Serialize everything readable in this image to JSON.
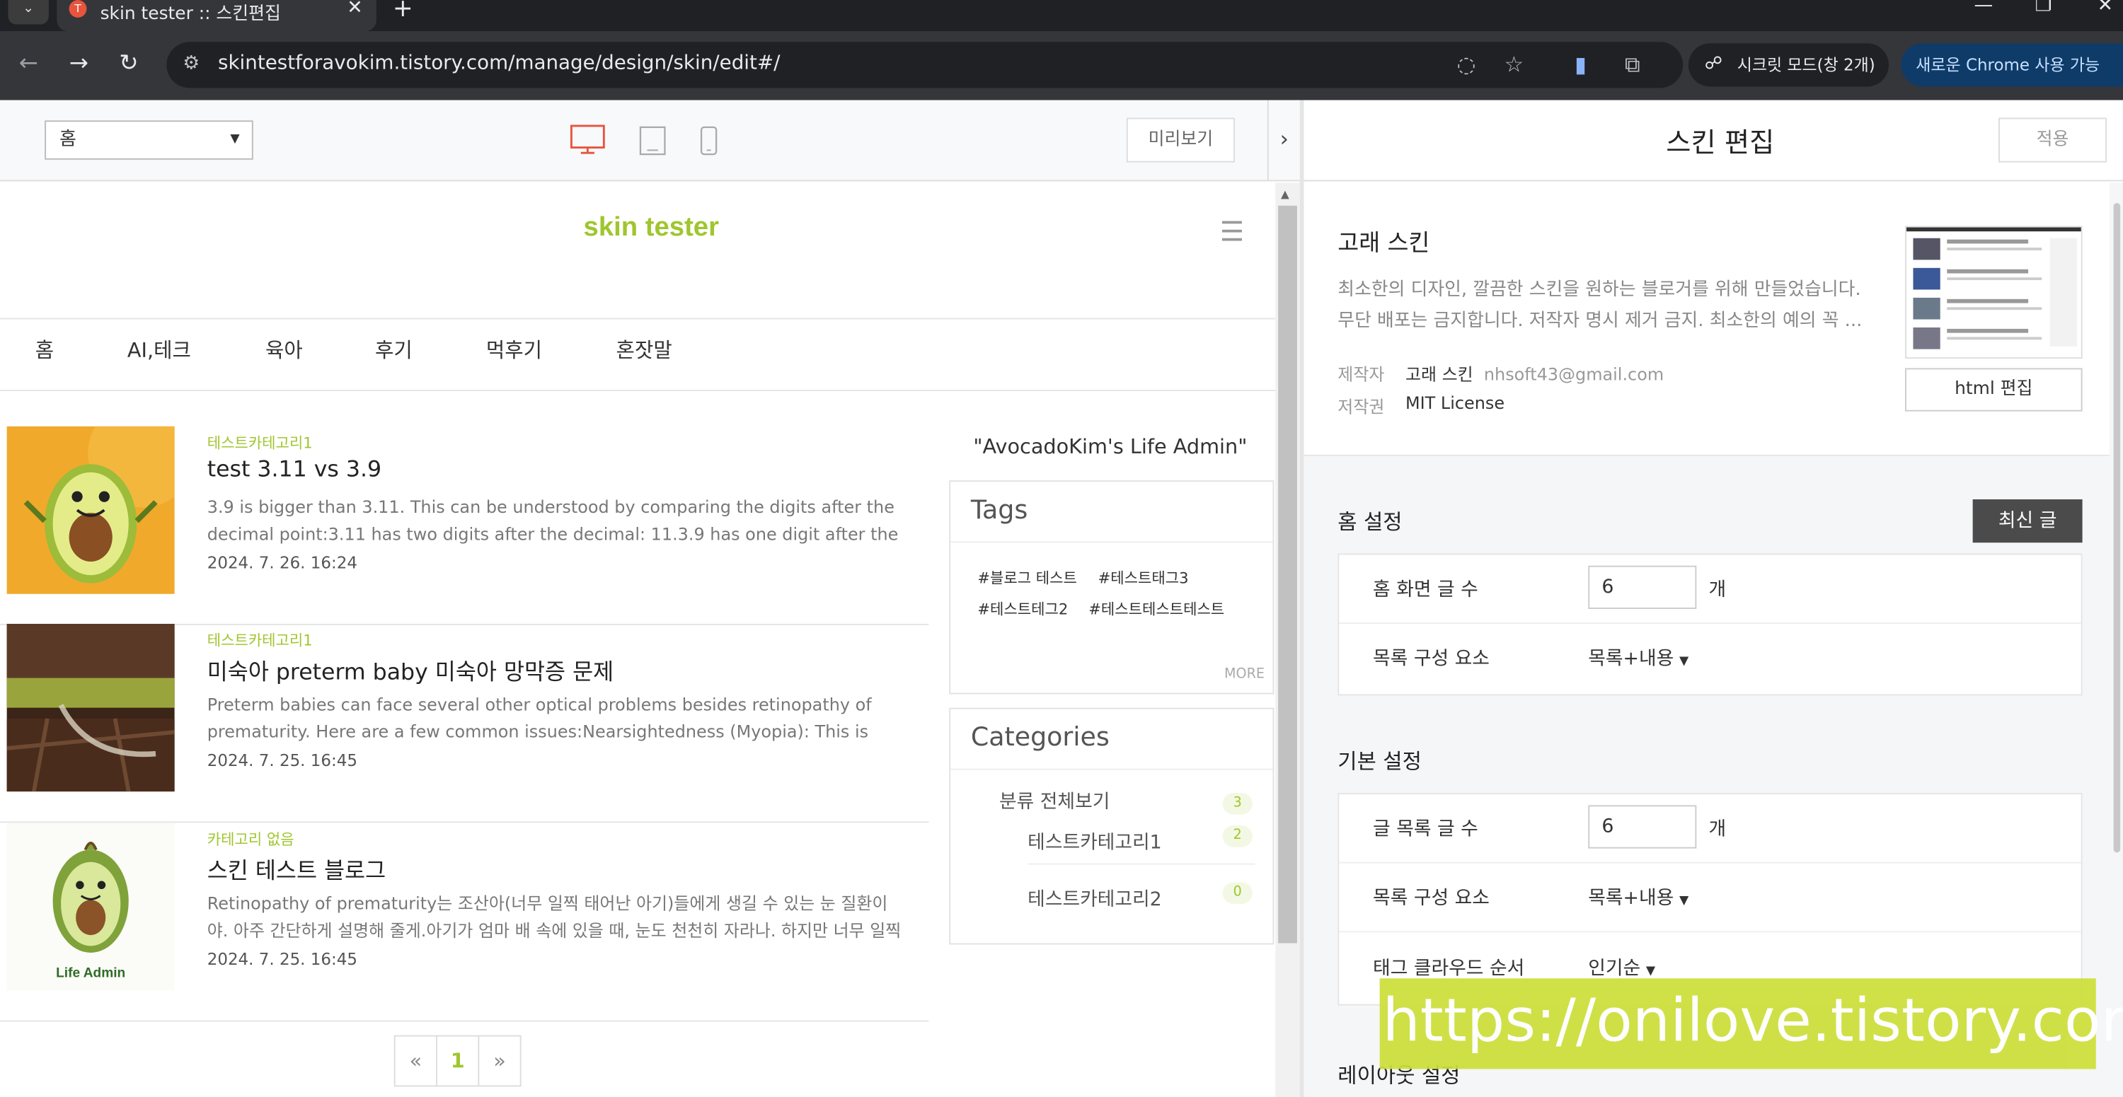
{
  "browser": {
    "tab_title": "skin tester :: 스킨편집",
    "url": "skintestforavokim.tistory.com/manage/design/skin/edit#/",
    "incognito_label": "시크릿 모드(창 2개)",
    "new_chrome_label": "새로운 Chrome 사용 가능"
  },
  "editor": {
    "page_select_value": "홈",
    "preview_button": "미리보기"
  },
  "blog": {
    "title": "skin tester",
    "nav": [
      "홈",
      "AI,테크",
      "육아",
      "후기",
      "먹후기",
      "혼잣말"
    ],
    "posts": [
      {
        "category": "테스트카테고리1",
        "title": "test 3.11 vs 3.9",
        "summary": "3.9 is bigger than 3.11. This can be understood by comparing the digits after the decimal point:3.11 has two digits after the decimal: 11.3.9 has one digit after the",
        "date": "2024. 7. 26. 16:24"
      },
      {
        "category": "테스트카테고리1",
        "title": "미숙아 preterm baby 미숙아 망막증 문제",
        "summary": "Preterm babies can face several other optical problems besides retinopathy of prematurity. Here are a few common issues:Nearsightedness (Myopia): This is when a",
        "date": "2024. 7. 25. 16:45"
      },
      {
        "category": "카테고리 없음",
        "title": "스킨 테스트 블로그",
        "summary": "Retinopathy of prematurity는 조산아(너무 일찍 태어난 아기)들에게 생길 수 있는 눈 질환이야. 아주 간단하게 설명해 줄게.아기가 엄마 배 속에 있을 때, 눈도 천천히 자라나. 하지만 너무 일찍 태어나",
        "date": "2024. 7. 25. 16:45"
      }
    ],
    "thumb3_caption": "Life Admin",
    "pagination": {
      "prev": "«",
      "current": "1",
      "next": "»"
    },
    "quote": "\"AvocadoKim's Life Admin\"",
    "tags_widget": {
      "title": "Tags",
      "tags": [
        "#블로그 테스트",
        "#테스트태그3",
        "#테스트테그2",
        "#테스트테스트테스트"
      ],
      "more": "MORE"
    },
    "categories_widget": {
      "title": "Categories",
      "all_label": "분류 전체보기",
      "all_count": "3",
      "items": [
        {
          "name": "테스트카테고리1",
          "count": "2"
        },
        {
          "name": "테스트카테고리2",
          "count": "0"
        }
      ]
    }
  },
  "panel": {
    "title": "스킨 편집",
    "apply_button": "적용",
    "skin_name": "고래 스킨",
    "skin_desc": "최소한의 디자인, 깔끔한 스킨을 원하는 블로거를 위해 만들었습니다. 무단 배포는 금지합니다. 저작자 명시 제거 금지. 최소한의 예의 꼭 ...",
    "author_label": "제작자",
    "author_name": "고래 스킨",
    "author_email": "nhsoft43@gmail.com",
    "license_label": "저작권",
    "license_value": "MIT License",
    "html_edit_button": "html 편집",
    "home_settings": {
      "title": "홈 설정",
      "recent_button": "최신 글",
      "post_count_label": "홈 화면 글 수",
      "post_count_value": "6",
      "unit": "개",
      "list_elements_label": "목록 구성 요소",
      "list_elements_value": "목록+내용"
    },
    "basic_settings": {
      "title": "기본 설정",
      "post_count_label": "글 목록 글 수",
      "post_count_value": "6",
      "unit": "개",
      "list_elements_label": "목록 구성 요소",
      "list_elements_value": "목록+내용",
      "tag_cloud_label": "태그 클라우드 순서",
      "tag_cloud_value": "인기순"
    },
    "layout_settings_title": "레이아웃 설정"
  },
  "watermark": "https://onilove.tistory.com",
  "colors": {
    "accent_green": "#9fc62e",
    "device_active": "#e8543c",
    "dark_button": "#4b4b4b"
  }
}
